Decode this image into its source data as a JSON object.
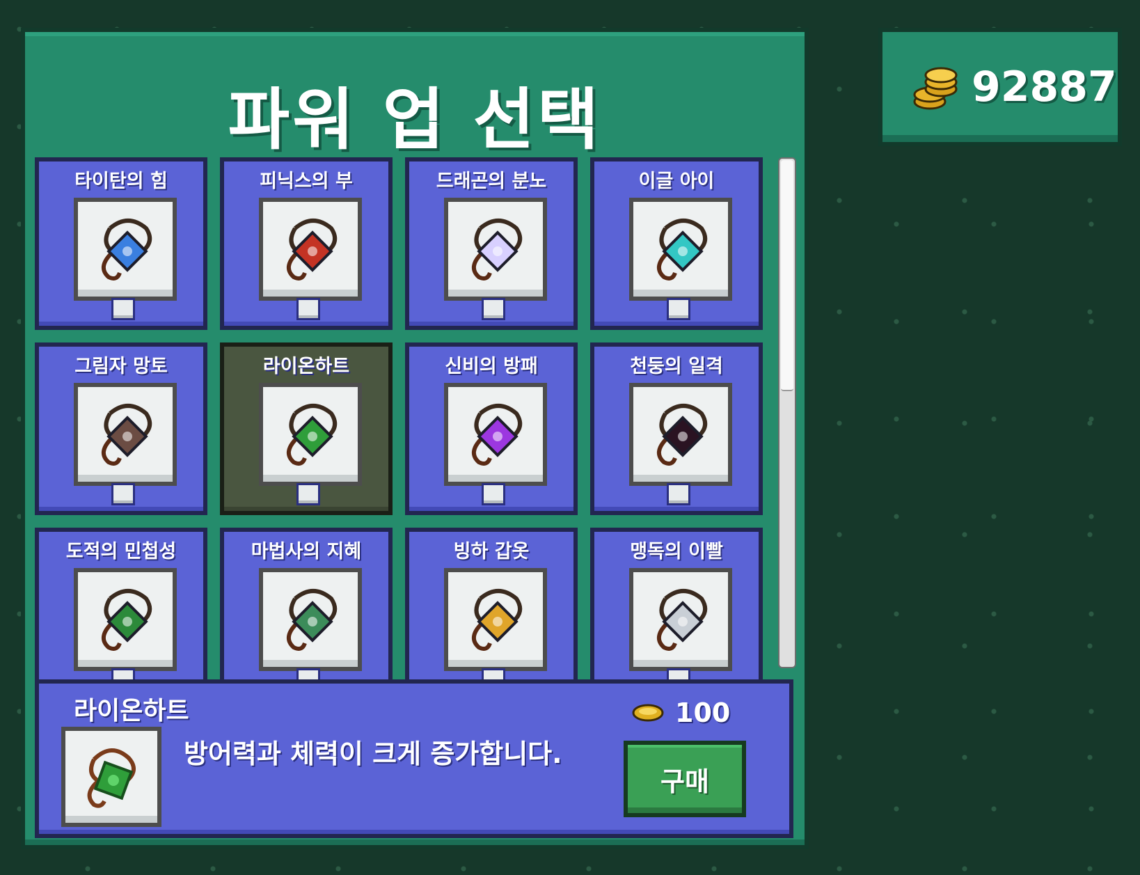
{
  "title": "파워 업 선택",
  "coins": {
    "amount": "92887",
    "icon": "coin-stack-icon"
  },
  "powerups": [
    {
      "name": "타이탄의 힘",
      "icon": "blue-crystal-amulet-icon",
      "color": "#3a7fe0"
    },
    {
      "name": "피닉스의 부",
      "icon": "red-phoenix-amulet-icon",
      "color": "#c43324"
    },
    {
      "name": "드래곤의 분노",
      "icon": "white-gem-amulet-icon",
      "color": "#d8d0ff"
    },
    {
      "name": "이글 아이",
      "icon": "cyan-orb-amulet-icon",
      "color": "#33c7c4"
    },
    {
      "name": "그림자 망토",
      "icon": "shadow-cloak-icon",
      "color": "#6b4c43"
    },
    {
      "name": "라이온하트",
      "icon": "green-lion-amulet-icon",
      "color": "#2f9e3a",
      "selected": true
    },
    {
      "name": "신비의 방패",
      "icon": "purple-gem-amulet-icon",
      "color": "#9c37e0"
    },
    {
      "name": "천둥의 일격",
      "icon": "dark-stone-icon",
      "color": "#2a1322"
    },
    {
      "name": "도적의 민첩성",
      "icon": "green-hood-icon",
      "color": "#2c8a3a"
    },
    {
      "name": "마법사의 지혜",
      "icon": "green-crown-icon",
      "color": "#3c8c5a"
    },
    {
      "name": "빙하 갑옷",
      "icon": "gold-skull-crown-icon",
      "color": "#e0a52a"
    },
    {
      "name": "맹독의 이빨",
      "icon": "silver-cage-icon",
      "color": "#c9cfd6"
    }
  ],
  "detail": {
    "name": "라이온하트",
    "description": "방어력과 체력이 크게 증가합니다.",
    "price": "100",
    "price_icon": "coin-icon",
    "buy_label": "구매",
    "icon": "green-lion-amulet-icon"
  }
}
